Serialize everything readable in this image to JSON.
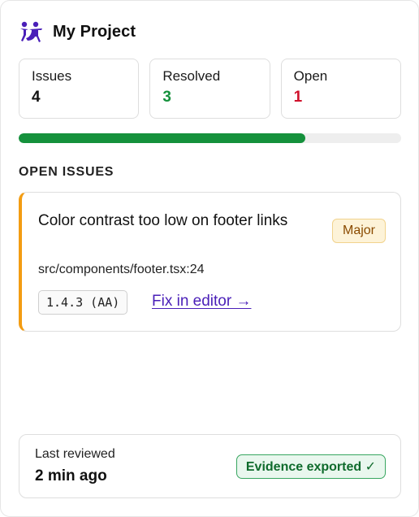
{
  "header": {
    "title": "My Project",
    "logo_icon": "accessibility-figures-icon",
    "logo_color": "#4a1fb8"
  },
  "stats": [
    {
      "label": "Issues",
      "value": "4",
      "color": "#111111"
    },
    {
      "label": "Resolved",
      "value": "3",
      "color": "#15913c"
    },
    {
      "label": "Open",
      "value": "1",
      "color": "#d0112b"
    }
  ],
  "progress": {
    "fraction": 0.75,
    "color": "#15913c"
  },
  "section": {
    "title": "OPEN ISSUES"
  },
  "issues": [
    {
      "title": "Color contrast too low on footer links",
      "severity": "Major",
      "path": "src/components/footer.tsx:24",
      "criterion": "1.4.3 (AA)",
      "fix_label": "Fix in editor →",
      "accent_color": "#f39c12"
    }
  ],
  "footer": {
    "label": "Last reviewed",
    "value": "2 min ago",
    "badge": "Evidence exported ✓"
  }
}
